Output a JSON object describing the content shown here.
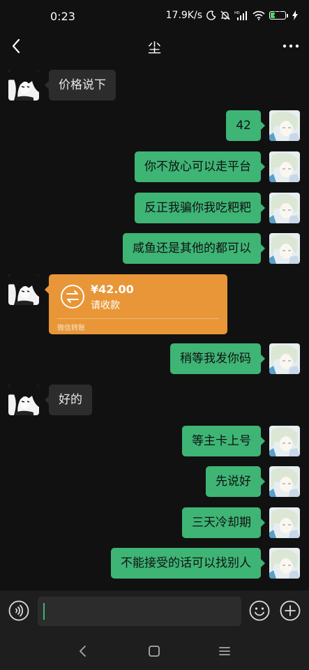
{
  "status_bar": {
    "time": "0:23",
    "network_speed": "17.9K/s",
    "battery": "23",
    "icons": [
      "moon-icon",
      "mute-bell-icon",
      "hd-signal-icon",
      "wifi-icon",
      "battery-icon",
      "charging-icon"
    ]
  },
  "nav": {
    "title": "尘",
    "back_icon": "chevron-left-icon",
    "more_icon": "more-dots-icon"
  },
  "messages": [
    {
      "side": "in",
      "text": "价格说下"
    },
    {
      "side": "out",
      "text": "42"
    },
    {
      "side": "out",
      "text": "你不放心可以走平台"
    },
    {
      "side": "out",
      "text": "反正我骗你我吃粑粑"
    },
    {
      "side": "out",
      "text": "咸鱼还是其他的都可以"
    },
    {
      "side": "in",
      "type": "transfer"
    },
    {
      "side": "out",
      "text": "稍等我发你码"
    },
    {
      "side": "in",
      "text": "好的"
    },
    {
      "side": "out",
      "text": "等主卡上号"
    },
    {
      "side": "out",
      "text": "先说好"
    },
    {
      "side": "out",
      "text": "三天冷却期"
    },
    {
      "side": "out",
      "text": "不能接受的话可以找别人"
    }
  ],
  "transfer": {
    "amount": "¥42.00",
    "status": "请收款",
    "footer": "微信转账",
    "icon": "transfer-arrows-icon"
  },
  "input_bar": {
    "value": "",
    "voice_icon": "voice-icon",
    "emoji_icon": "emoji-icon",
    "plus_icon": "plus-circle-icon"
  },
  "system_nav": {
    "icons": [
      "back-icon",
      "home-icon",
      "menu-icon"
    ]
  },
  "colors": {
    "background": "#111111",
    "outgoing_bubble": "#3eb575",
    "incoming_bubble": "#2c2c2c",
    "transfer_card": "#e89637"
  }
}
